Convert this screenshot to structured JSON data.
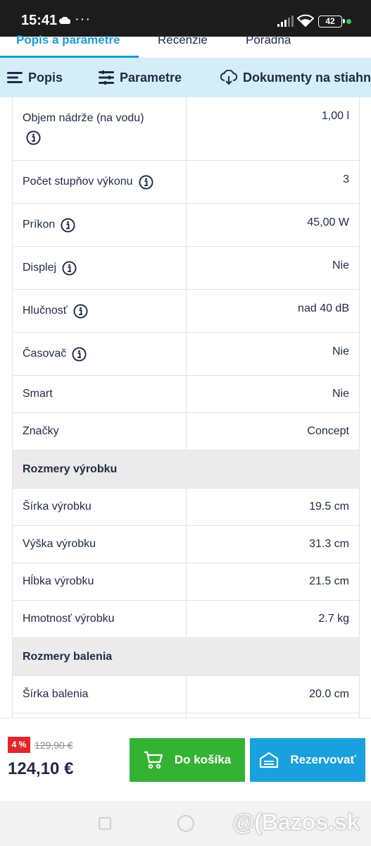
{
  "status_bar": {
    "time": "15:41",
    "dots": "···",
    "battery": "42"
  },
  "tabs": [
    {
      "label": "Popis a parametre",
      "active": true
    },
    {
      "label": "Recenzie",
      "active": false
    },
    {
      "label": "Poradňa",
      "active": false
    }
  ],
  "section_nav": [
    {
      "label": "Popis",
      "icon": "list-icon"
    },
    {
      "label": "Parametre",
      "icon": "sliders-icon"
    },
    {
      "label": "Dokumenty na stiahn",
      "icon": "cloud-download-icon"
    }
  ],
  "params": [
    {
      "label": "Objem nádrže (na vodu)",
      "value": "1,00 l",
      "info": true,
      "wrap": true
    },
    {
      "label": "Počet stupňov výkonu",
      "value": "3",
      "info": true
    },
    {
      "label": "Príkon",
      "value": "45,00 W",
      "info": true
    },
    {
      "label": "Displej",
      "value": "Nie",
      "info": true
    },
    {
      "label": "Hlučnosť",
      "value": "nad 40 dB",
      "info": true
    },
    {
      "label": "Časovač",
      "value": "Nie",
      "info": true
    },
    {
      "label": "Smart",
      "value": "Nie",
      "info": false
    },
    {
      "label": "Značky",
      "value": "Concept",
      "info": false
    },
    {
      "section": "Rozmery výrobku"
    },
    {
      "label": "Šírka výrobku",
      "value": "19.5 cm",
      "info": false
    },
    {
      "label": "Výška výrobku",
      "value": "31.3 cm",
      "info": false
    },
    {
      "label": "Hĺbka výrobku",
      "value": "21.5 cm",
      "info": false
    },
    {
      "label": "Hmotnosť výrobku",
      "value": "2.7 kg",
      "info": false
    },
    {
      "section": "Rozmery balenia"
    },
    {
      "label": "Šírka balenia",
      "value": "20.0 cm",
      "info": false
    },
    {
      "label": "",
      "value": "",
      "info": false
    }
  ],
  "purchase": {
    "discount": "4 %",
    "old_price": "129,90 €",
    "price": "124,10 €",
    "cart_button": "Do košíka",
    "reserve_button": "Rezervovať"
  },
  "watermark": "@(Bazos.sk",
  "colors": {
    "accent": "#1a9bd7",
    "cart": "#34b233",
    "reserve": "#1aa0de",
    "discount": "#e0262b",
    "nav_bg": "#d4eef8"
  }
}
